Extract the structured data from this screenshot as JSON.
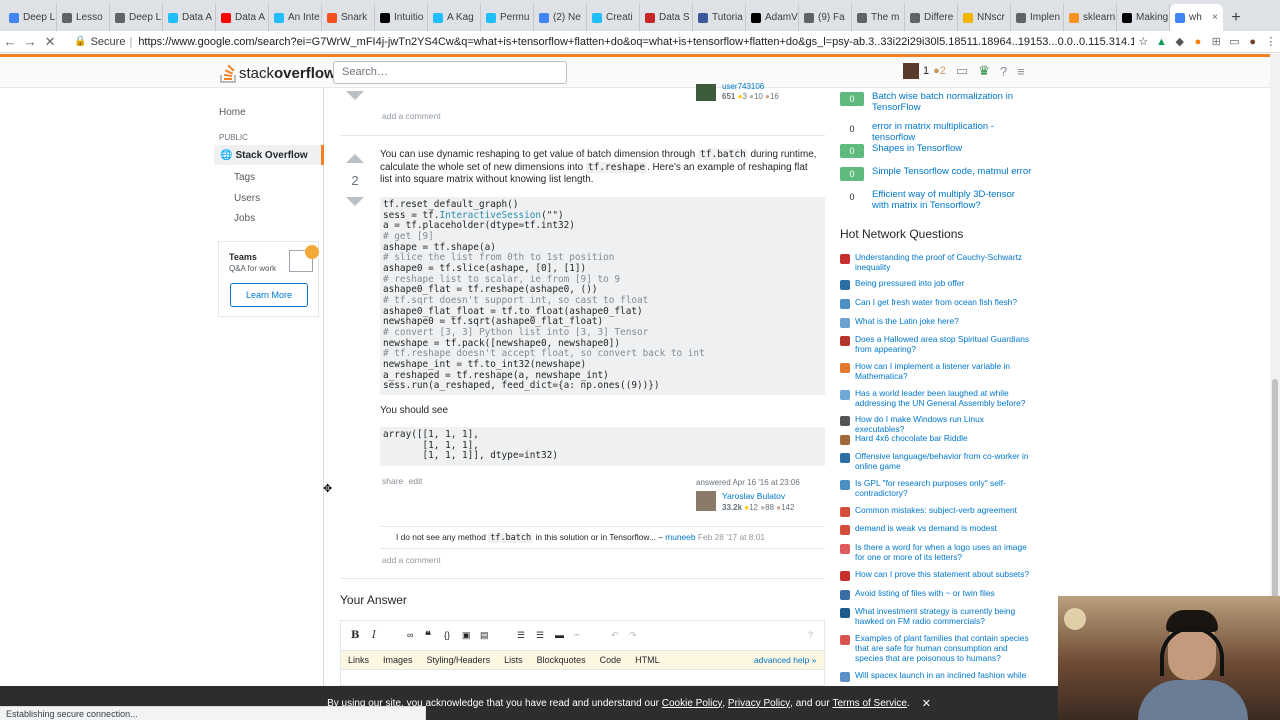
{
  "browser": {
    "tabs": [
      {
        "label": "Deep L",
        "icon": "doc-icon",
        "color": "#4285f4"
      },
      {
        "label": "Lesso",
        "icon": "globe-icon",
        "color": "#5f6368"
      },
      {
        "label": "Deep L",
        "icon": "globe-icon",
        "color": "#5f6368"
      },
      {
        "label": "Data A",
        "icon": "kaggle-icon",
        "color": "#20beff"
      },
      {
        "label": "Data A",
        "icon": "youtube-icon",
        "color": "#ff0000"
      },
      {
        "label": "An Inte",
        "icon": "kaggle-icon",
        "color": "#20beff"
      },
      {
        "label": "Snark",
        "icon": "snark-icon",
        "color": "#f4511e"
      },
      {
        "label": "Intuitio",
        "icon": "m-icon",
        "color": "#000000"
      },
      {
        "label": "A Kag",
        "icon": "kaggle-icon",
        "color": "#20beff"
      },
      {
        "label": "Permu",
        "icon": "kaggle-icon",
        "color": "#20beff"
      },
      {
        "label": "(2) Ne",
        "icon": "globe-icon",
        "color": "#4285f4"
      },
      {
        "label": "Creati",
        "icon": "kaggle-icon",
        "color": "#20beff"
      },
      {
        "label": "Data S",
        "icon": "shield-icon",
        "color": "#c62828"
      },
      {
        "label": "Tutoria",
        "icon": "facebook-icon",
        "color": "#3b5998"
      },
      {
        "label": "AdamV",
        "icon": "m-icon",
        "color": "#000000"
      },
      {
        "label": "(9) Fa",
        "icon": "globe-icon",
        "color": "#5f6368"
      },
      {
        "label": "The m",
        "icon": "doc-icon",
        "color": "#5f6368"
      },
      {
        "label": "Differe",
        "icon": "globe-icon",
        "color": "#5f6368"
      },
      {
        "label": "NNscr",
        "icon": "glasses-icon",
        "color": "#f4b400"
      },
      {
        "label": "Implen",
        "icon": "doc-icon",
        "color": "#5f6368"
      },
      {
        "label": "sklearn",
        "icon": "sklearn-icon",
        "color": "#f7931e"
      },
      {
        "label": "Making",
        "icon": "m-icon",
        "color": "#000000"
      },
      {
        "label": "wh",
        "icon": "loading-icon",
        "color": "#4285f4"
      }
    ],
    "secure_label": "Secure",
    "url": "https://www.google.com/search?ei=G7WrW_mFI4j-jwTn2YS4Cw&q=what+is+tensorflow+flatten+do&oq=what+is+tensorflow+flatten+do&gs_l=psy-ab.3..33i22i29i30l5.18511.18964..19153...0.0..0.115.314.1j2......0....1..gws-w...",
    "status": "Establishing secure connection..."
  },
  "so": {
    "logo_light": "stack",
    "logo_bold": "overflow",
    "search_placeholder": "Search…",
    "rep": "1",
    "bronze": "●2"
  },
  "leftnav": {
    "home": "Home",
    "public": "PUBLIC",
    "stackoverflow": "Stack Overflow",
    "tags": "Tags",
    "users": "Users",
    "jobs": "Jobs",
    "teams_title": "Teams",
    "teams_sub": "Q&A for work",
    "learn_more": "Learn More"
  },
  "prev": {
    "user": "user743106",
    "rep": "651",
    "gold": "3",
    "silver": "10",
    "bronze": "16",
    "add_comment": "add a comment"
  },
  "answer": {
    "votes": "2",
    "p1a": "You can use dynamic reshaping to get value of batch dimension through",
    "code1": "tf.batch",
    "p1b": "during runtime, calculate the whole set of new dimensions into",
    "code2": "tf.reshape",
    "p1c": ". Here's an example of reshaping flat list into square matrix without knowing list length.",
    "code_lines": [
      {
        "t": "tf.reset_default_graph()",
        "k": "n"
      },
      {
        "t": "sess = tf.InteractiveSession(\"\")",
        "k": "n"
      },
      {
        "t": "a = tf.placeholder(dtype=tf.int32)",
        "k": "n"
      },
      {
        "t": "# get [9]",
        "k": "c"
      },
      {
        "t": "ashape = tf.shape(a)",
        "k": "n"
      },
      {
        "t": "# slice the list from 0th to 1st position",
        "k": "c"
      },
      {
        "t": "ashape0 = tf.slice(ashape, [0], [1])",
        "k": "n"
      },
      {
        "t": "# reshape list to scalar, ie from [9] to 9",
        "k": "c"
      },
      {
        "t": "ashape0_flat = tf.reshape(ashape0, ())",
        "k": "n"
      },
      {
        "t": "# tf.sqrt doesn't support int, so cast to float",
        "k": "c"
      },
      {
        "t": "ashape0_flat_float = tf.to_float(ashape0_flat)",
        "k": "n"
      },
      {
        "t": "newshape0 = tf.sqrt(ashape0_flat_float)",
        "k": "n"
      },
      {
        "t": "# convert [3, 3] Python list into [3, 3] Tensor",
        "k": "c"
      },
      {
        "t": "newshape = tf.pack([newshape0, newshape0])",
        "k": "n"
      },
      {
        "t": "# tf.reshape doesn't accept float, so convert back to int",
        "k": "c"
      },
      {
        "t": "newshape_int = tf.to_int32(newshape)",
        "k": "n"
      },
      {
        "t": "a_reshaped = tf.reshape(a, newshape_int)",
        "k": "n"
      },
      {
        "t": "sess.run(a_reshaped, feed_dict={a: np.ones((9))})",
        "k": "n"
      }
    ],
    "you_should_see": "You should see",
    "output_lines": [
      "array([[1, 1, 1],",
      "       [1, 1, 1],",
      "       [1, 1, 1]], dtype=int32)"
    ],
    "share": "share",
    "edit": "edit",
    "answered": "answered Apr 16 '16 at 23:06",
    "author": "Yaroslav Bulatov",
    "author_rep": "33.2k",
    "gold": "12",
    "silver": "88",
    "bronze": "142",
    "comment_a": "I do not see any method",
    "comment_code": "tf.batch",
    "comment_b": "in this solution or in Tensorflow...",
    "comment_dash": "–",
    "comment_user": "muneeb",
    "comment_date": "Feb 28 '17 at 8:01",
    "add_comment": "add a comment"
  },
  "your_answer": {
    "title": "Your Answer",
    "help_tabs": [
      "Links",
      "Images",
      "Styling/Headers",
      "Lists",
      "Blockquotes",
      "Code",
      "HTML"
    ],
    "advanced": "advanced help »"
  },
  "related": [
    {
      "count": "0",
      "title": "Batch wise batch normalization in TensorFlow",
      "pos": true
    },
    {
      "count": "0",
      "title": "error in matrix multiplication - tensorflow",
      "pos": false
    },
    {
      "count": "0",
      "title": "Shapes in Tensorflow",
      "pos": true
    },
    {
      "count": "0",
      "title": "Simple Tensorflow code, matmul error",
      "pos": true
    },
    {
      "count": "0",
      "title": "Efficient way of multiply 3D-tensor with matrix in Tensorflow?",
      "pos": false
    }
  ],
  "hnq_title": "Hot Network Questions",
  "hnq": [
    {
      "t": "Understanding the proof of Cauchy-Schwartz inequality",
      "c": "#c72f2f"
    },
    {
      "t": "Being pressured into job offer",
      "c": "#2a6ea6"
    },
    {
      "t": "Can I get fresh water from ocean fish flesh?",
      "c": "#4a90c2"
    },
    {
      "t": "What is the Latin joke here?",
      "c": "#6aa1d0"
    },
    {
      "t": "Does a Hallowed area stop Spiritual Guardians from appearing?",
      "c": "#b5342c"
    },
    {
      "t": "How can I implement a listener variable in Mathematica?",
      "c": "#e07a2a"
    },
    {
      "t": "Has a world leader been laughed at while addressing the UN General Assembly before?",
      "c": "#6fa7d6"
    },
    {
      "t": "How do I make Windows run Linux executables?",
      "c": "#555555"
    },
    {
      "t": "Hard 4x6 chocolate bar Riddle",
      "c": "#a06a3a"
    },
    {
      "t": "Offensive language/behavior from co-worker in online game",
      "c": "#2a6ea6"
    },
    {
      "t": "Is GPL \"for research purposes only\" self-contradictory?",
      "c": "#4a90c2"
    },
    {
      "t": "Common mistakes: subject-verb agreement",
      "c": "#d24d3a"
    },
    {
      "t": "demand is weak vs demand is modest",
      "c": "#d24d3a"
    },
    {
      "t": "Is there a word for when a logo uses an image for one or more of its letters?",
      "c": "#e05b5b"
    },
    {
      "t": "How can I prove this statement about subsets?",
      "c": "#c72f2f"
    },
    {
      "t": "Avoid listing of files with ~ or twin files",
      "c": "#3a6ea5"
    },
    {
      "t": "What investment strategy is currently being hawked on FM radio commercials?",
      "c": "#1c5a8a"
    },
    {
      "t": "Examples of plant families that contain species that are safe for human consumption and species that are poisonous to humans?",
      "c": "#d9534f"
    },
    {
      "t": "Will spacex launch in an inclined fashion while",
      "c": "#5b8fc7"
    }
  ],
  "cookie": {
    "pre": "By using our site, you acknowledge that you have read and understand our",
    "cookie_policy": "Cookie Policy",
    "comma": ",",
    "privacy": "Privacy Policy",
    "and": ", and our",
    "tos": "Terms of Service",
    "end": ".",
    "close": "✕"
  }
}
